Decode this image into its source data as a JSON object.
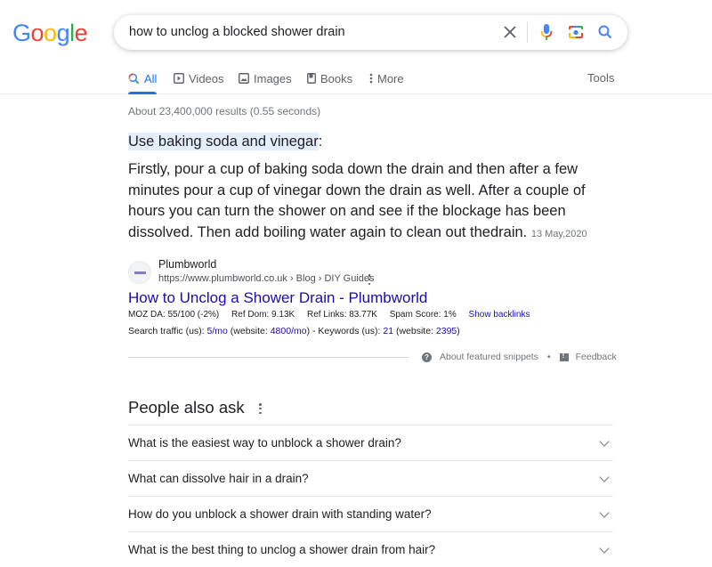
{
  "logo": {
    "letters": [
      "G",
      "o",
      "o",
      "g",
      "l",
      "e"
    ]
  },
  "search": {
    "query": "how to unclog a blocked shower drain",
    "icons": [
      "clear-icon",
      "microphone-icon",
      "camera-lens-icon",
      "search-icon"
    ]
  },
  "tabs": [
    {
      "label": "All",
      "icon": "search-icon",
      "active": true
    },
    {
      "label": "Videos",
      "icon": "play-icon"
    },
    {
      "label": "Images",
      "icon": "image-icon"
    },
    {
      "label": "Books",
      "icon": "book-icon"
    },
    {
      "label": "More",
      "icon": "more-vert-icon"
    }
  ],
  "tools_label": "Tools",
  "stats": "About 23,400,000 results (0.55 seconds)",
  "featured_snippet": {
    "heading": "Use baking soda and vinegar",
    "heading_suffix": ":",
    "body": "Firstly, pour a cup of baking soda down the drain and then after a few minutes pour a cup of vinegar down the drain as well. After a couple of hours you can turn the shower on and see if the blockage has been dissolved. Then add boiling water again to clean out thedrain.",
    "date": "13 May,2020"
  },
  "source": {
    "site_name": "Plumbworld",
    "url": "https://www.plumbworld.co.uk › Blog › DIY Guides",
    "title": "How to Unclog a Shower Drain - Plumbworld"
  },
  "moz": {
    "da": "MOZ DA: 55/100 (-2%)",
    "ref_dom": "Ref Dom: 9.13K",
    "ref_links": "Ref Links: 83.77K",
    "spam": "Spam Score: 1%",
    "show_backlinks": "Show backlinks"
  },
  "traffic": {
    "label": "Search traffic (us): ",
    "page_traffic": "5/mo",
    "website_label": " (website: ",
    "website_traffic": "4800/mo",
    "keywords_label": ") - Keywords (us): ",
    "keywords": "21",
    "website_keywords": "2395",
    "close": ")"
  },
  "about_snippets": "About featured snippets",
  "separator": "•",
  "feedback": "Feedback",
  "paa": {
    "title": "People also ask",
    "questions": [
      "What is the easiest way to unblock a shower drain?",
      "What can dissolve hair in a drain?",
      "How do you unblock a shower drain with standing water?",
      "What is the best thing to unclog a shower drain from hair?"
    ]
  }
}
